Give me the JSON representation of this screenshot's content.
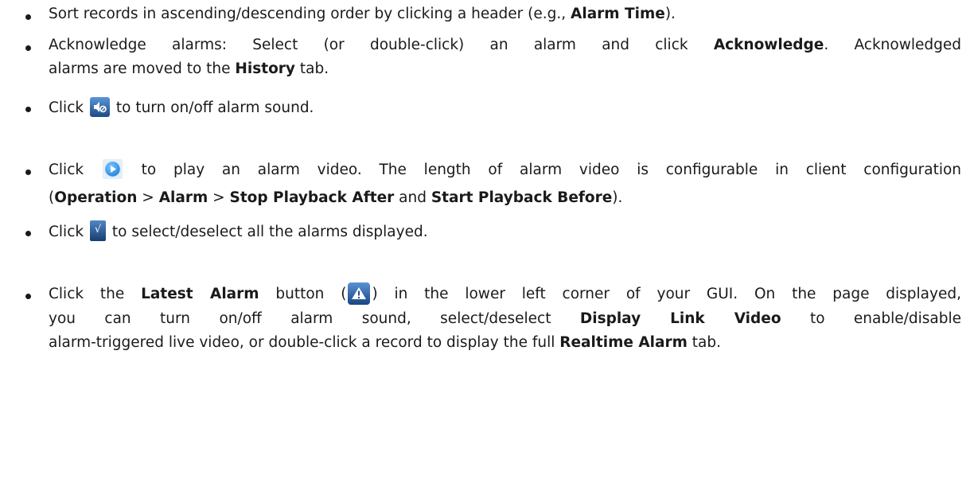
{
  "items": [
    {
      "pre": "Sort records in ascending/descending order by clicking a header (e.g., ",
      "b1": "Alarm Time",
      "post": ")."
    },
    {
      "l1_pre": "Acknowledge alarms: Select (or double-click) an alarm and click ",
      "l1_b": "Acknowledge",
      "l1_post": ". Acknowledged",
      "l2_pre": "alarms are moved to the ",
      "l2_b": "History",
      "l2_post": " tab."
    },
    {
      "pre": "Click",
      "icon": "sound-toggle-icon",
      "post": "to turn on/off alarm sound."
    },
    {
      "pre": "Click",
      "icon": "play-video-icon",
      "post": "to play an alarm video. The length of alarm video is configurable in client configuration",
      "l2_open": "(",
      "l2_b1": "Operation",
      "l2_sep1": " > ",
      "l2_b2": "Alarm",
      "l2_sep2": " > ",
      "l2_b3": "Stop Playback After",
      "l2_and": " and ",
      "l2_b4": "Start Playback Before",
      "l2_close": ")."
    },
    {
      "pre": "Click",
      "icon": "select-all-check-icon",
      "post": "to select/deselect all the alarms displayed."
    },
    {
      "l1_pre": "Click the ",
      "l1_b": "Latest Alarm",
      "l1_mid": " button (",
      "icon": "latest-alarm-warning-icon",
      "l1_post": ") in the lower left corner of your GUI. On the page displayed,",
      "l2_pre": "you can turn on/off alarm sound, select/deselect ",
      "l2_b": "Display Link Video",
      "l2_post": " to enable/disable",
      "l3_pre": "alarm-triggered live video, or double-click a record to display the full ",
      "l3_b": "Realtime Alarm",
      "l3_post": " tab."
    }
  ],
  "colors": {
    "text": "#1a1a1a",
    "icon_blue_dark": "#1f4f8c",
    "icon_blue_light": "#4d8fd6",
    "play_blue": "#2a8fe0"
  }
}
